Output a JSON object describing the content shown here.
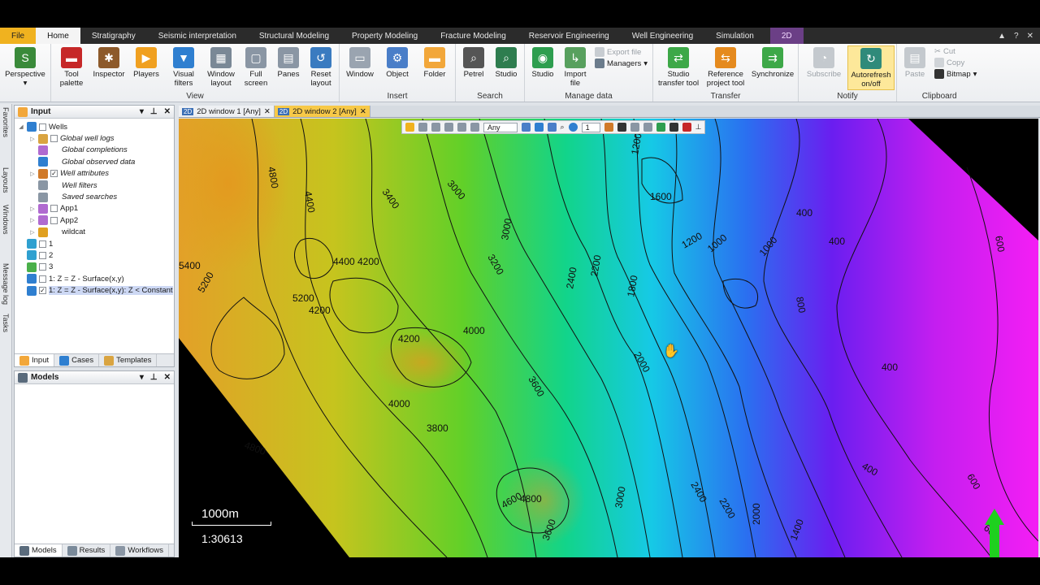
{
  "ribbon_tabs": [
    "File",
    "Home",
    "Stratigraphy",
    "Seismic interpretation",
    "Structural Modeling",
    "Property Modeling",
    "Fracture Modeling",
    "Reservoir Engineering",
    "Well Engineering",
    "Simulation",
    "2D"
  ],
  "window_controls": [
    "▲",
    "?",
    "✕"
  ],
  "ribbon": {
    "perspective": "Perspective",
    "view_buttons": [
      "Tool palette",
      "Inspector",
      "Players",
      "Visual filters",
      "Window layout",
      "Full screen",
      "Panes",
      "Reset layout"
    ],
    "view_label": "View",
    "insert_buttons": [
      "Window",
      "Object",
      "Folder"
    ],
    "insert_label": "Insert",
    "search_buttons": [
      "Petrel",
      "Studio"
    ],
    "search_label": "Search",
    "manage_buttons": [
      "Studio",
      "Import file"
    ],
    "manage_small": [
      "Export file",
      "Managers"
    ],
    "manage_label": "Manage data",
    "transfer_buttons": [
      "Studio transfer tool",
      "Reference project tool",
      "Synchronize"
    ],
    "transfer_label": "Transfer",
    "notify_buttons": [
      "Subscribe",
      "Autorefresh on/off"
    ],
    "notify_label": "Notify",
    "clipboard_paste": "Paste",
    "clipboard_small": [
      "Cut",
      "Copy",
      "Bitmap"
    ],
    "clipboard_label": "Clipboard"
  },
  "side_strip": [
    "Favorites",
    "Layouts",
    "Windows",
    "Message log",
    "Tasks"
  ],
  "input_panel": {
    "title": "Input",
    "tree": [
      {
        "label": "Wells",
        "italic": false,
        "checked": false,
        "indent": 0
      },
      {
        "label": "Global well logs",
        "italic": true,
        "checked": false,
        "indent": 1
      },
      {
        "label": "Global completions",
        "italic": true,
        "checked": null,
        "indent": 1
      },
      {
        "label": "Global observed data",
        "italic": true,
        "checked": null,
        "indent": 1
      },
      {
        "label": "Well attributes",
        "italic": true,
        "checked": true,
        "indent": 1
      },
      {
        "label": "Well filters",
        "italic": true,
        "checked": null,
        "indent": 1
      },
      {
        "label": "Saved searches",
        "italic": true,
        "checked": null,
        "indent": 1
      },
      {
        "label": "App1",
        "italic": false,
        "checked": false,
        "indent": 1
      },
      {
        "label": "App2",
        "italic": false,
        "checked": false,
        "indent": 1
      },
      {
        "label": "wildcat",
        "italic": false,
        "checked": null,
        "indent": 1
      },
      {
        "label": "1",
        "italic": false,
        "checked": false,
        "indent": 0
      },
      {
        "label": "2",
        "italic": false,
        "checked": false,
        "indent": 0
      },
      {
        "label": "3",
        "italic": false,
        "checked": false,
        "indent": 0
      },
      {
        "label": "1: Z = Z - Surface(x,y)",
        "italic": false,
        "checked": false,
        "indent": 0
      },
      {
        "label": "1: Z = Z - Surface(x,y): Z < Constant",
        "italic": false,
        "checked": true,
        "indent": 0
      }
    ],
    "tabs": [
      "Input",
      "Cases",
      "Templates"
    ]
  },
  "models_panel": {
    "title": "Models",
    "tabs": [
      "Models",
      "Results",
      "Workflows"
    ]
  },
  "doc_tabs": [
    {
      "badge": "2D",
      "label": "2D window 1 [Any]"
    },
    {
      "badge": "2D",
      "label": "2D window 2 [Any]"
    }
  ],
  "map_toolbar": {
    "filter": "Any",
    "zoom": "1"
  },
  "contour_labels": [
    "4800",
    "4600",
    "4400",
    "4200",
    "4000",
    "3800",
    "3600",
    "3400",
    "3200",
    "3000",
    "2800",
    "2600",
    "2400",
    "2200",
    "2000",
    "1800",
    "1600",
    "1400",
    "1200",
    "1000",
    "800",
    "600",
    "400",
    "5200",
    "5400",
    "1600"
  ],
  "scale": {
    "length": "1000m",
    "ratio": "1:30613"
  }
}
